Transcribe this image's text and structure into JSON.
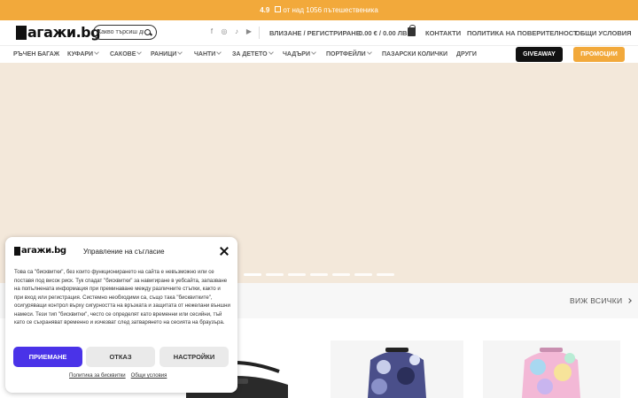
{
  "promo_bar": {
    "rating": "4.9",
    "text": "от над 1056 пътешественика"
  },
  "header": {
    "logo_text": "агажи.bg",
    "search_placeholder": "Какво търсиш днес?",
    "social_icons": [
      "facebook-icon",
      "instagram-icon",
      "tiktok-icon",
      "youtube-icon"
    ],
    "login_label": "ВЛИЗАНЕ / РЕГИСТРИРАНЕ",
    "cart_label": "0.00 € / 0.00 ЛВ.",
    "links": [
      "КОНТАКТИ",
      "ПОЛИТИКА НА ПОВЕРИТЕЛНОСТ",
      "ОБЩИ УСЛОВИЯ"
    ]
  },
  "nav": {
    "items": [
      {
        "label": "РЪЧЕН БАГАЖ",
        "has_dropdown": false
      },
      {
        "label": "КУФАРИ",
        "has_dropdown": true
      },
      {
        "label": "САКОВЕ",
        "has_dropdown": true
      },
      {
        "label": "РАНИЦИ",
        "has_dropdown": true
      },
      {
        "label": "ЧАНТИ",
        "has_dropdown": true
      },
      {
        "label": "ЗА ДЕТЕТО",
        "has_dropdown": true
      },
      {
        "label": "ЧАДЪРИ",
        "has_dropdown": true
      },
      {
        "label": "ПОРТФЕЙЛИ",
        "has_dropdown": true
      },
      {
        "label": "ПАЗАРСКИ КОЛИЧКИ",
        "has_dropdown": false
      },
      {
        "label": "ДРУГИ",
        "has_dropdown": false
      }
    ],
    "giveaway_label": "GIVEAWAY",
    "promo_label": "ПРОМОЦИИ"
  },
  "section": {
    "view_all_label": "ВИЖ ВСИЧКИ"
  },
  "cookie_modal": {
    "logo_text": "агажи.bg",
    "title": "Управление на съгласие",
    "body": "Това са \"бисквитки\", без които функционирането на сайта е невъзможно или се поставя под висок риск. Тук спадат \"бисквитки\" за навигиране в уебсайта, запазване на попълнената информация при преминаване между различните стъпки, както и при вход или регистрация. Системно необходими са, също така \"бисквитките\", осигуряващи контрол върху сигурността на връзката и защитата от нежелани външни намеси. Тези тип \"бисквитки\", често се определят като временни или сесийни, тъй като се съхраняват временно и изчезват след затварянето на сесията на браузъра.",
    "accept_label": "ПРИЕМАНЕ",
    "deny_label": "ОТКАЗ",
    "settings_label": "НАСТРОЙКИ",
    "link_cookie_policy": "Политика за бисквитки",
    "link_terms": "Общи условия"
  },
  "colors": {
    "accent_orange": "#f2a93b",
    "accept_blue": "#4a33e8",
    "hero_bg": "#f3e8da",
    "dark": "#111111"
  }
}
